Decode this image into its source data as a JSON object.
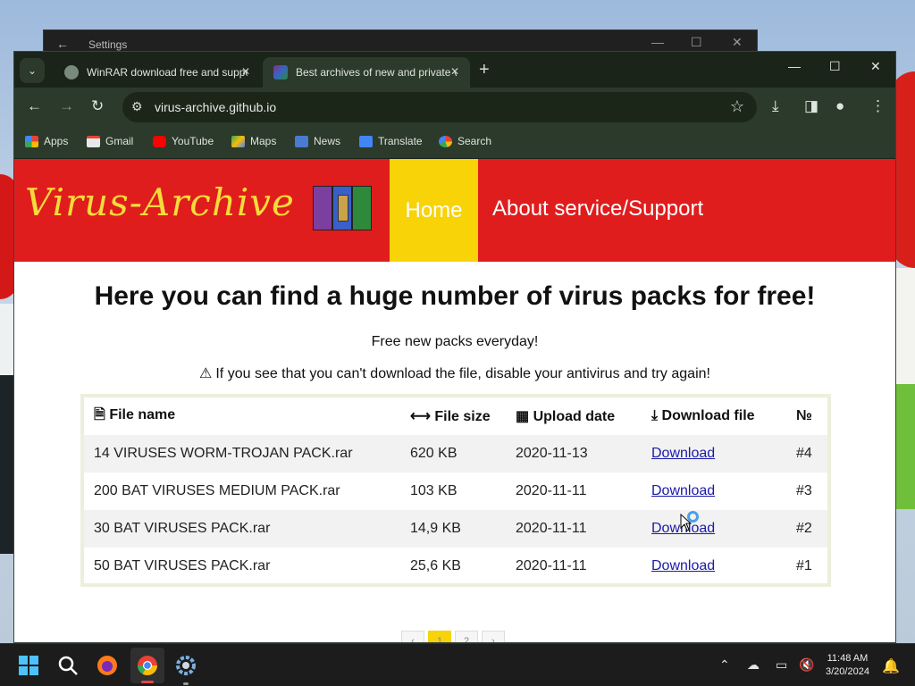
{
  "settings_window": {
    "title": "Settings"
  },
  "browser": {
    "tabs": [
      {
        "label": "WinRAR download free and support: WinRAR",
        "active": false
      },
      {
        "label": "Best archives of new and private viruses",
        "active": true
      }
    ],
    "url": "virus-archive.github.io",
    "bookmarks": [
      "Apps",
      "Gmail",
      "YouTube",
      "Maps",
      "News",
      "Translate",
      "Search"
    ]
  },
  "site": {
    "logo_text": "Virus-Archive",
    "nav": {
      "home": "Home",
      "about": "About service/Support"
    },
    "headline": "Here you can find a huge number of virus packs for free!",
    "subline": "Free new packs everyday!",
    "warning": "If you see that you can't download the file, disable your antivirus and try again!",
    "table": {
      "headers": [
        "File name",
        "File size",
        "Upload date",
        "Download file",
        "№"
      ],
      "rows": [
        {
          "name": "14 VIRUSES WORM-TROJAN PACK.rar",
          "size": "620 KB",
          "date": "2020-11-13",
          "link": "Download",
          "num": "#4"
        },
        {
          "name": "200 BAT VIRUSES MEDIUM PACK.rar",
          "size": "103 KB",
          "date": "2020-11-11",
          "link": "Download",
          "num": "#3"
        },
        {
          "name": "30 BAT VIRUSES PACK.rar",
          "size": "14,9 KB",
          "date": "2020-11-11",
          "link": "Download",
          "num": "#2"
        },
        {
          "name": "50 BAT VIRUSES PACK.rar",
          "size": "25,6 KB",
          "date": "2020-11-11",
          "link": "Download",
          "num": "#1"
        }
      ]
    },
    "pager": {
      "prev": "‹",
      "pages": [
        "1",
        "2"
      ],
      "next": "›"
    }
  },
  "taskbar": {
    "time": "11:48 AM",
    "date": "3/20/2024"
  },
  "colors": {
    "header_red": "#e01d1d",
    "nav_yellow": "#f7d308",
    "logo_yellow": "#f5dc3a",
    "link_blue": "#1a1aaa"
  }
}
